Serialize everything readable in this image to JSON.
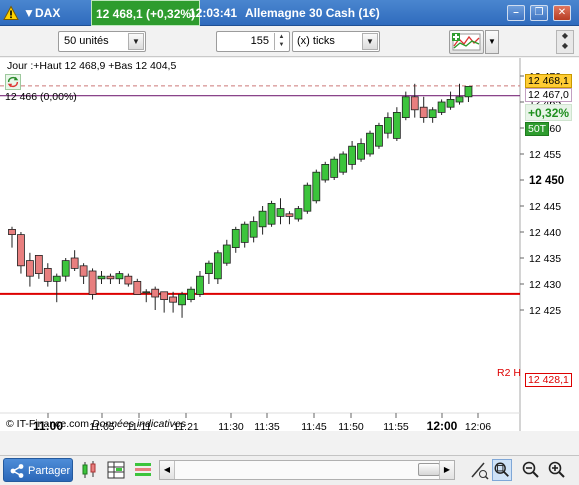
{
  "titlebar": {
    "dropdown_glyph": "▼",
    "symbol": "DAX",
    "quote": "12 468,1 (+0,32%)",
    "time": "12:03:41",
    "instrument": "Allemagne 30 Cash (1€)",
    "warning_icon": "warning-icon",
    "minimize_glyph": "–",
    "restore_glyph": "❐",
    "close_glyph": "✕"
  },
  "toolbar": {
    "units_value": "50 unités",
    "ticks_value": "155",
    "ticks_type": "(x) ticks",
    "dropdown_glyph": "▼",
    "spin_up": "▲",
    "spin_down": "▼",
    "grip_glyph": "◆"
  },
  "chart": {
    "ohlc_label": "Jour :+Haut 12 468,9 +Bas 12 404,5",
    "reference_label": "12 466 (0,00%)",
    "copyright": "© IT-Finance.com",
    "copyright_note": "Données indicatives",
    "last_price_tag": "12 468,1",
    "reference_price_tag": "12 467,0",
    "change_tag": "+0,32%",
    "timeframe_tag": "50T",
    "r2_label": "R2 H",
    "r2_tag": "12 428,1",
    "colors": {
      "up": "#3cc43c",
      "down": "#e87f7f",
      "r2_line": "#dd0000",
      "ref_line": "#7a2a7a",
      "last_line": "#c77"
    }
  },
  "chart_data": {
    "type": "candlestick",
    "title": "",
    "ylim": [
      12421.5,
      12472.5
    ],
    "y_ticks": [
      12425,
      12430,
      12435,
      12440,
      12445,
      12450,
      12455,
      12460,
      12465,
      12470
    ],
    "y_tick_labels": [
      "12 425",
      "12 430",
      "12 435",
      "12 440",
      "12 445",
      "12 450",
      "12 455",
      "12 460",
      "12 465",
      "12 470"
    ],
    "y_bold_ticks": [
      12450
    ],
    "x_labels": [
      "11:00",
      "11:05",
      "11:11",
      "11:21",
      "11:30",
      "11:35",
      "11:45",
      "11:50",
      "11:55",
      "12:00",
      "12:06"
    ],
    "x_bold_labels": [
      "11:00",
      "12:00"
    ],
    "candles": [
      {
        "o": 12440.5,
        "h": 12441,
        "l": 12437,
        "c": 12439.5
      },
      {
        "o": 12439.5,
        "h": 12440,
        "l": 12432,
        "c": 12433.5
      },
      {
        "o": 12434.5,
        "h": 12436,
        "l": 12429.5,
        "c": 12431.5
      },
      {
        "o": 12435.5,
        "h": 12435.5,
        "l": 12431,
        "c": 12432
      },
      {
        "o": 12433,
        "h": 12434,
        "l": 12429.5,
        "c": 12430.5
      },
      {
        "o": 12430.5,
        "h": 12432,
        "l": 12426.5,
        "c": 12431.5
      },
      {
        "o": 12431.5,
        "h": 12435,
        "l": 12430.5,
        "c": 12434.5
      },
      {
        "o": 12435,
        "h": 12436.5,
        "l": 12432.5,
        "c": 12433
      },
      {
        "o": 12433.5,
        "h": 12434,
        "l": 12430,
        "c": 12431.5
      },
      {
        "o": 12432.5,
        "h": 12433,
        "l": 12427,
        "c": 12428
      },
      {
        "o": 12431,
        "h": 12432.5,
        "l": 12430,
        "c": 12431.5
      },
      {
        "o": 12431.5,
        "h": 12432,
        "l": 12430,
        "c": 12431
      },
      {
        "o": 12431,
        "h": 12432.5,
        "l": 12430,
        "c": 12432
      },
      {
        "o": 12431.5,
        "h": 12432,
        "l": 12429.5,
        "c": 12430
      },
      {
        "o": 12430.5,
        "h": 12431,
        "l": 12428,
        "c": 12428
      },
      {
        "o": 12428.5,
        "h": 12429,
        "l": 12426.5,
        "c": 12428.5
      },
      {
        "o": 12429,
        "h": 12429.5,
        "l": 12425,
        "c": 12427.5
      },
      {
        "o": 12428.5,
        "h": 12428.5,
        "l": 12424.5,
        "c": 12427
      },
      {
        "o": 12427.5,
        "h": 12428.5,
        "l": 12424.5,
        "c": 12426.5
      },
      {
        "o": 12426,
        "h": 12428.5,
        "l": 12423.5,
        "c": 12428
      },
      {
        "o": 12427,
        "h": 12429.5,
        "l": 12426.5,
        "c": 12429
      },
      {
        "o": 12428,
        "h": 12432.5,
        "l": 12427.5,
        "c": 12431.5
      },
      {
        "o": 12432,
        "h": 12434.5,
        "l": 12430,
        "c": 12434
      },
      {
        "o": 12431,
        "h": 12436.5,
        "l": 12430,
        "c": 12436
      },
      {
        "o": 12434,
        "h": 12438.5,
        "l": 12433.5,
        "c": 12437.5
      },
      {
        "o": 12437,
        "h": 12441,
        "l": 12436,
        "c": 12440.5
      },
      {
        "o": 12438,
        "h": 12442,
        "l": 12437,
        "c": 12441.5
      },
      {
        "o": 12439,
        "h": 12443,
        "l": 12438,
        "c": 12442
      },
      {
        "o": 12441,
        "h": 12445,
        "l": 12439.5,
        "c": 12444
      },
      {
        "o": 12441.5,
        "h": 12446,
        "l": 12441,
        "c": 12445.5
      },
      {
        "o": 12443,
        "h": 12446.5,
        "l": 12441.5,
        "c": 12444.5
      },
      {
        "o": 12443.5,
        "h": 12444,
        "l": 12441.5,
        "c": 12443
      },
      {
        "o": 12442.5,
        "h": 12445,
        "l": 12442,
        "c": 12444.5
      },
      {
        "o": 12444,
        "h": 12449.5,
        "l": 12443.5,
        "c": 12449
      },
      {
        "o": 12446,
        "h": 12452,
        "l": 12445.5,
        "c": 12451.5
      },
      {
        "o": 12450,
        "h": 12453.5,
        "l": 12449.5,
        "c": 12453
      },
      {
        "o": 12450.5,
        "h": 12454.5,
        "l": 12450,
        "c": 12454
      },
      {
        "o": 12451.5,
        "h": 12455.5,
        "l": 12451,
        "c": 12455
      },
      {
        "o": 12453,
        "h": 12457.5,
        "l": 12452,
        "c": 12456.5
      },
      {
        "o": 12454,
        "h": 12458,
        "l": 12453.5,
        "c": 12457
      },
      {
        "o": 12455,
        "h": 12459.5,
        "l": 12454.5,
        "c": 12459
      },
      {
        "o": 12456.5,
        "h": 12461,
        "l": 12456,
        "c": 12460.5
      },
      {
        "o": 12459,
        "h": 12463,
        "l": 12458,
        "c": 12462
      },
      {
        "o": 12458,
        "h": 12464,
        "l": 12457.5,
        "c": 12463
      },
      {
        "o": 12462,
        "h": 12467,
        "l": 12461.5,
        "c": 12466
      },
      {
        "o": 12466,
        "h": 12468.5,
        "l": 12462,
        "c": 12463.5
      },
      {
        "o": 12464,
        "h": 12466,
        "l": 12461,
        "c": 12462
      },
      {
        "o": 12462,
        "h": 12464,
        "l": 12461,
        "c": 12463.5
      },
      {
        "o": 12463,
        "h": 12465.5,
        "l": 12462.5,
        "c": 12465
      },
      {
        "o": 12464,
        "h": 12467,
        "l": 12463.5,
        "c": 12465.5
      },
      {
        "o": 12465,
        "h": 12468.5,
        "l": 12464.5,
        "c": 12466
      },
      {
        "o": 12466,
        "h": 12468,
        "l": 12465,
        "c": 12468
      }
    ],
    "r2_level": 12428.1,
    "reference_level": 12466.6,
    "last_level": 12468.1
  },
  "bottombar": {
    "share_label": "Partager",
    "scroll_left_glyph": "◀",
    "scroll_right_glyph": "▶",
    "icons": [
      "share-icon",
      "candlestick-type-icon",
      "table-icon",
      "indicator-list-icon",
      "drawing-tool-icon",
      "zoom-fit-icon",
      "zoom-out-icon",
      "zoom-in-icon"
    ]
  }
}
